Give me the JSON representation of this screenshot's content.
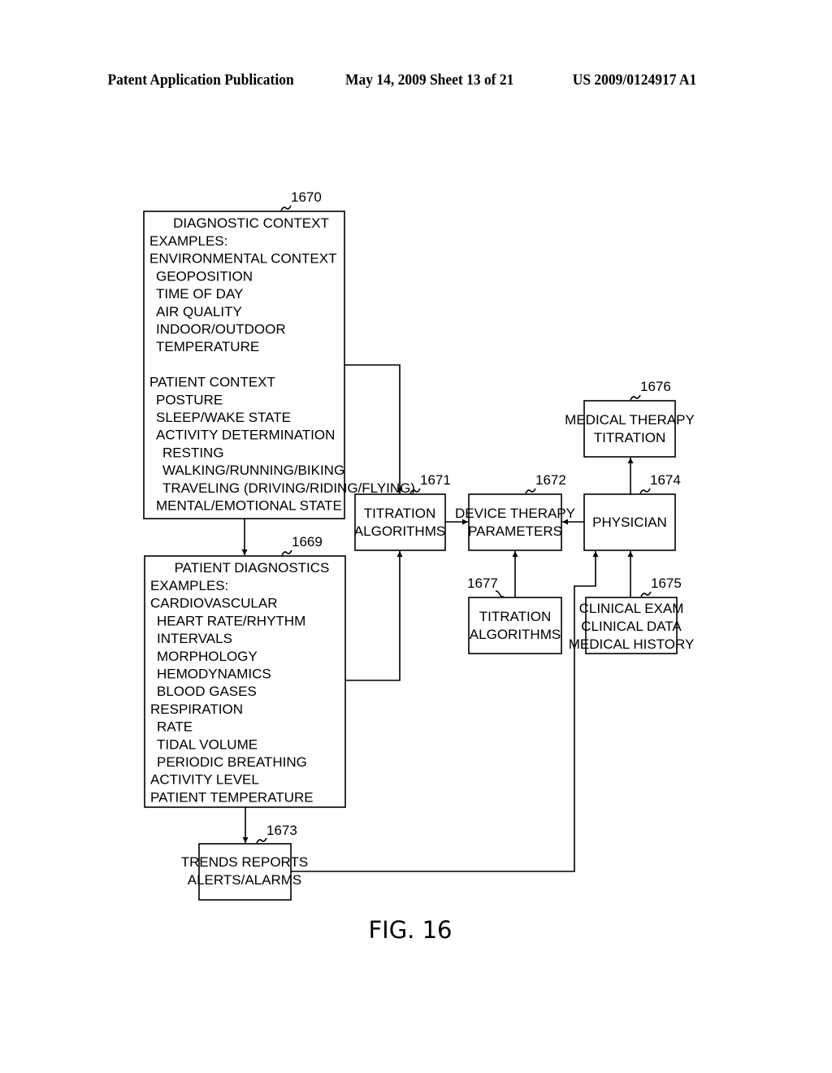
{
  "header": {
    "publication": "Patent Application Publication",
    "date_sheet": "May 14, 2009  Sheet 13 of 21",
    "number": "US 2009/0124917 A1"
  },
  "figure_label": "FIG. 16",
  "boxes": {
    "diagnostic_context": {
      "ref": "1670",
      "title": "DIAGNOSTIC CONTEXT",
      "lines": [
        {
          "text": "EXAMPLES:",
          "indent": 0
        },
        {
          "text": "ENVIRONMENTAL CONTEXT",
          "indent": 0
        },
        {
          "text": "GEOPOSITION",
          "indent": 1
        },
        {
          "text": "TIME OF DAY",
          "indent": 1
        },
        {
          "text": "AIR QUALITY",
          "indent": 1
        },
        {
          "text": "INDOOR/OUTDOOR",
          "indent": 1
        },
        {
          "text": "TEMPERATURE",
          "indent": 1
        },
        {
          "text": "",
          "indent": 0
        },
        {
          "text": "PATIENT CONTEXT",
          "indent": 0
        },
        {
          "text": "POSTURE",
          "indent": 1
        },
        {
          "text": "SLEEP/WAKE STATE",
          "indent": 1
        },
        {
          "text": "ACTIVITY DETERMINATION",
          "indent": 1
        },
        {
          "text": "RESTING",
          "indent": 2
        },
        {
          "text": "WALKING/RUNNING/BIKING",
          "indent": 2
        },
        {
          "text": "TRAVELING (DRIVING/RIDING/FLYING)",
          "indent": 2
        },
        {
          "text": "MENTAL/EMOTIONAL STATE",
          "indent": 1
        }
      ]
    },
    "patient_diagnostics": {
      "ref": "1669",
      "title": "PATIENT DIAGNOSTICS",
      "lines": [
        {
          "text": "EXAMPLES:",
          "indent": 0
        },
        {
          "text": "CARDIOVASCULAR",
          "indent": 0
        },
        {
          "text": "HEART RATE/RHYTHM",
          "indent": 1
        },
        {
          "text": "INTERVALS",
          "indent": 1
        },
        {
          "text": "MORPHOLOGY",
          "indent": 1
        },
        {
          "text": "HEMODYNAMICS",
          "indent": 1
        },
        {
          "text": "BLOOD GASES",
          "indent": 1
        },
        {
          "text": "RESPIRATION",
          "indent": 0
        },
        {
          "text": "RATE",
          "indent": 1
        },
        {
          "text": "TIDAL VOLUME",
          "indent": 1
        },
        {
          "text": "PERIODIC BREATHING",
          "indent": 1
        },
        {
          "text": "ACTIVITY LEVEL",
          "indent": 0
        },
        {
          "text": "PATIENT TEMPERATURE",
          "indent": 0
        }
      ]
    },
    "titration_algorithms_1671": {
      "ref": "1671",
      "lines": [
        "TITRATION",
        "ALGORITHMS"
      ]
    },
    "device_therapy_parameters": {
      "ref": "1672",
      "lines": [
        "DEVICE THERAPY",
        "PARAMETERS"
      ]
    },
    "physician": {
      "ref": "1674",
      "lines": [
        "PHYSICIAN"
      ]
    },
    "medical_therapy_titration": {
      "ref": "1676",
      "lines": [
        "MEDICAL THERAPY",
        "TITRATION"
      ]
    },
    "titration_algorithms_1677": {
      "ref": "1677",
      "lines": [
        "TITRATION",
        "ALGORITHMS"
      ]
    },
    "clinical_inputs": {
      "ref": "1675",
      "lines": [
        "CLINICAL EXAM",
        "CLINICAL DATA",
        "MEDICAL HISTORY"
      ]
    },
    "trends_reports": {
      "ref": "1673",
      "lines": [
        "TRENDS REPORTS",
        "ALERTS/ALARMS"
      ]
    }
  },
  "connections": [
    {
      "from": "1670",
      "to": "1669"
    },
    {
      "from": "1670",
      "to": "1671"
    },
    {
      "from": "1669",
      "to": "1671"
    },
    {
      "from": "1669",
      "to": "1673"
    },
    {
      "from": "1671",
      "to": "1672"
    },
    {
      "from": "1674",
      "to": "1672"
    },
    {
      "from": "1677",
      "to": "1672"
    },
    {
      "from": "1674",
      "to": "1676"
    },
    {
      "from": "1673",
      "to": "1674"
    },
    {
      "from": "1675",
      "to": "1674"
    }
  ]
}
